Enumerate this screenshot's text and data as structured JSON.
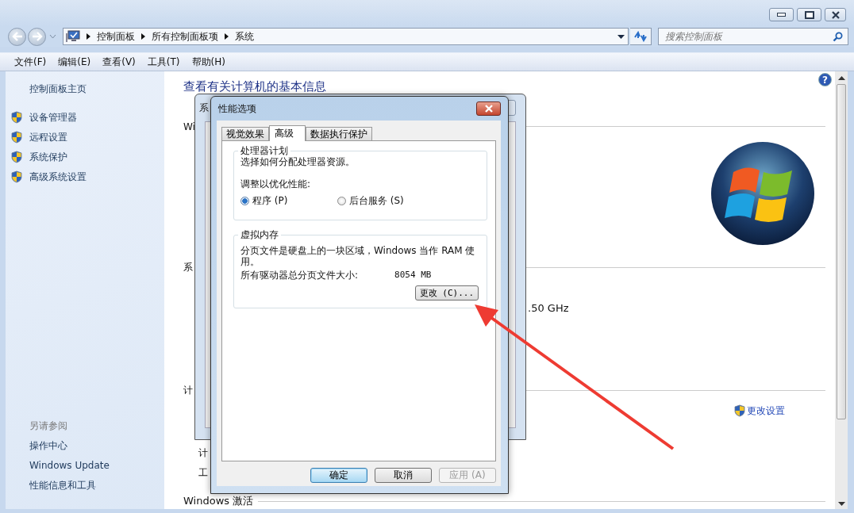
{
  "window": {
    "breadcrumb": [
      "控制面板",
      "所有控制面板项",
      "系统"
    ],
    "search": {
      "placeholder": "搜索控制面板"
    }
  },
  "menu": [
    "文件(F)",
    "编辑(E)",
    "查看(V)",
    "工具(T)",
    "帮助(H)"
  ],
  "sidebar": {
    "home": "控制面板主页",
    "tasks": [
      "设备管理器",
      "远程设置",
      "系统保护",
      "高级系统设置"
    ],
    "see_also_title": "另请参阅",
    "see_also": [
      "操作中心",
      "Windows Update",
      "性能信息和工具"
    ]
  },
  "content": {
    "heading": "查看有关计算机的基本信息",
    "section_1": "Wi",
    "section_2": "系",
    "cpu_speed": ".50 GHz",
    "section_3": "计",
    "change_settings": "更改设置",
    "row_1": "计",
    "row_2": "工",
    "section_4": "Windows 激活",
    "help": "?"
  },
  "back_dialog": {
    "title": "系"
  },
  "dialog": {
    "title": "性能选项",
    "tabs": [
      {
        "label": "视觉效果",
        "selected": false
      },
      {
        "label": "高级",
        "selected": true
      },
      {
        "label": "数据执行保护",
        "selected": false
      }
    ],
    "processor": {
      "title": "处理器计划",
      "description": "选择如何分配处理器资源。",
      "adjust_label": "调整以优化性能:",
      "options": [
        {
          "label": "程序 (P)",
          "selected": true
        },
        {
          "label": "后台服务 (S)",
          "selected": false
        }
      ]
    },
    "virtual_memory": {
      "title": "虚拟内存",
      "description": "分页文件是硬盘上的一块区域，Windows 当作 RAM 使用。",
      "total_label": "所有驱动器总分页文件大小:",
      "total_value": "8054 MB",
      "change_button": "更改 (C)..."
    },
    "buttons": [
      {
        "label": "确定",
        "kind": "default",
        "disabled": false
      },
      {
        "label": "取消",
        "kind": "normal",
        "disabled": false
      },
      {
        "label": "应用 (A)",
        "kind": "normal",
        "disabled": true
      }
    ]
  }
}
